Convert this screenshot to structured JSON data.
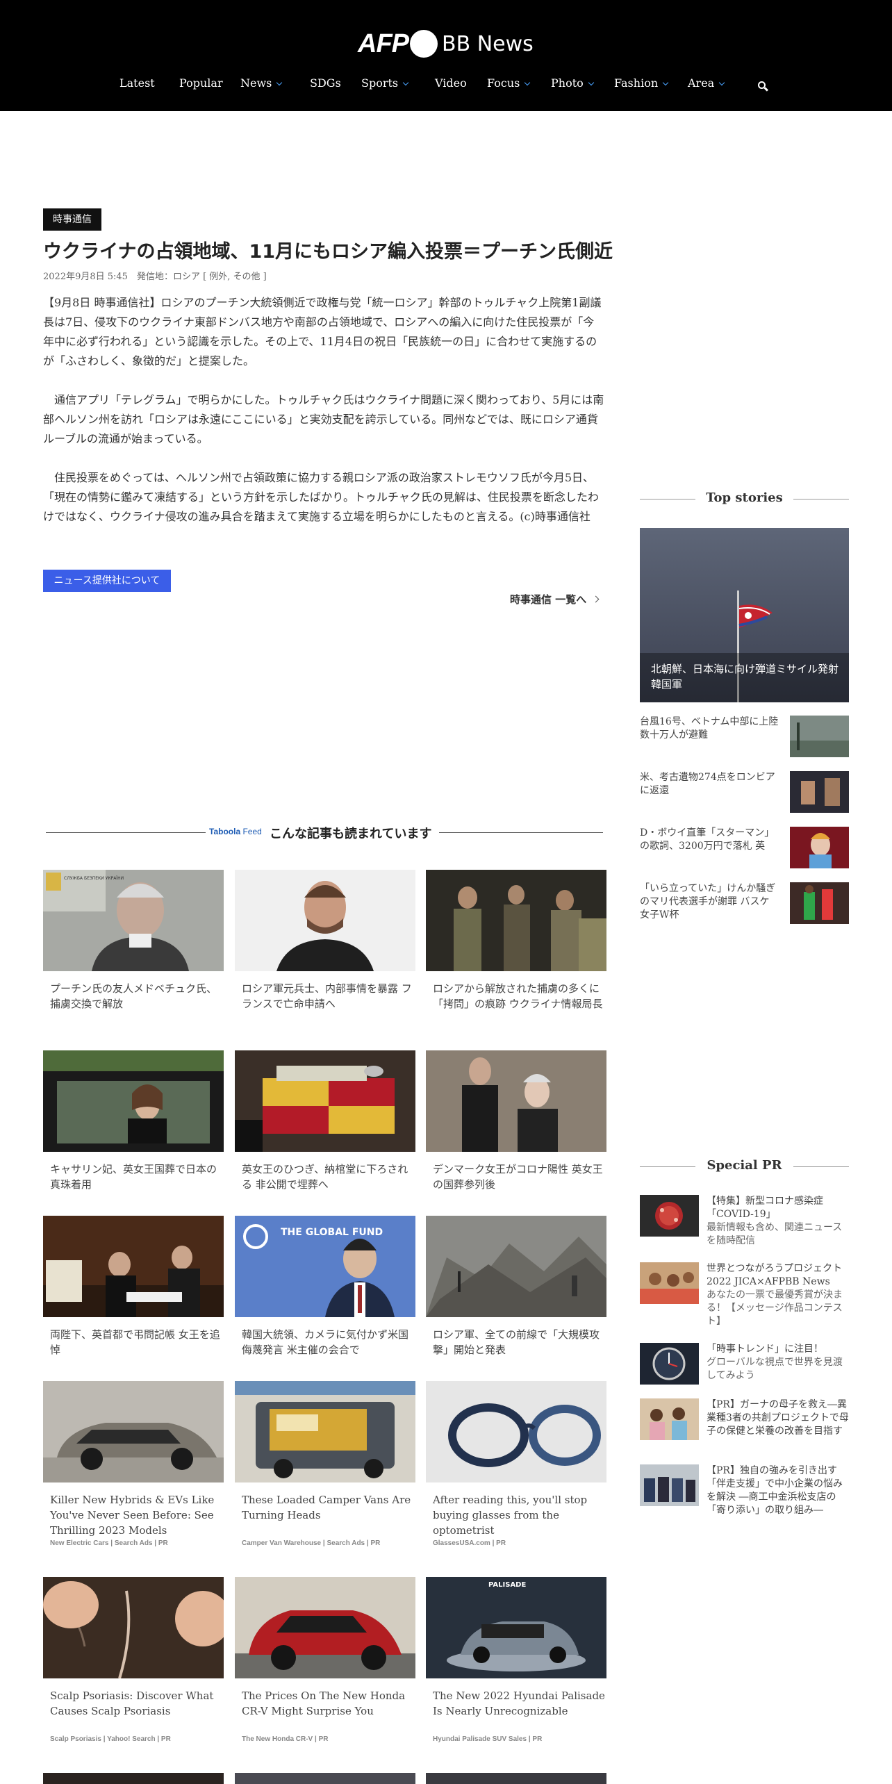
{
  "header": {
    "logo_afp": "AFP",
    "logo_bb": "BB News",
    "nav": [
      {
        "label": "Latest",
        "dropdown": false
      },
      {
        "label": "Popular",
        "dropdown": false
      },
      {
        "label": "News",
        "dropdown": true
      },
      {
        "label": "SDGs",
        "dropdown": false
      },
      {
        "label": "Sports",
        "dropdown": true
      },
      {
        "label": "Video",
        "dropdown": false
      },
      {
        "label": "Focus",
        "dropdown": true
      },
      {
        "label": "Photo",
        "dropdown": true
      },
      {
        "label": "Fashion",
        "dropdown": true
      },
      {
        "label": "Area",
        "dropdown": true
      }
    ],
    "search_icon": "search-icon"
  },
  "article": {
    "tag": "時事通信",
    "title": "ウクライナの占領地域、11月にもロシア編入投票＝プーチン氏側近",
    "meta": "2022年9月8日 5:45　発信地：ロシア [ 例外, その他 ]",
    "paragraphs": [
      "【9月8日 時事通信社】ロシアのプーチン大統領側近で政権与党「統一ロシア」幹部のトゥルチャク上院第1副議長は7日、侵攻下のウクライナ東部ドンバス地方や南部の占領地域で、ロシアへの編入に向けた住民投票が「今年中に必ず行われる」という認識を示した。その上で、11月4日の祝日「民族統一の日」に合わせて実施するのが「ふさわしく、象徴的だ」と提案した。",
      "　通信アプリ「テレグラム」で明らかにした。トゥルチャク氏はウクライナ問題に深く関わっており、5月には南部ヘルソン州を訪れ「ロシアは永遠にここにいる」と実効支配を誇示している。同州などでは、既にロシア通貨ルーブルの流通が始まっている。",
      "　住民投票をめぐっては、ヘルソン州で占領政策に協力する親ロシア派の政治家ストレモウソフ氏が今月5日、「現在の情勢に鑑みて凍結する」という方針を示したばかり。トゥルチャク氏の見解は、住民投票を断念したわけではなく、ウクライナ侵攻の進み具合を踏まえて実施する立場を明らかにしたものと言える。(c)時事通信社"
    ],
    "provider_button": "ニュース提供社について",
    "more_link": "時事通信 一覧へ"
  },
  "taboola": {
    "brand": "Taboola",
    "feed": "Feed",
    "heading": "こんな記事も読まれています"
  },
  "cards": [
    {
      "caption": "プーチン氏の友人メドベチュク氏、捕虜交換で解放",
      "source": ""
    },
    {
      "caption": "ロシア軍元兵士、内部事情を暴露 フランスで亡命申請へ",
      "source": ""
    },
    {
      "caption": "ロシアから解放された捕虜の多くに「拷問」の痕跡 ウクライナ情報局長",
      "source": ""
    },
    {
      "caption": "キャサリン妃、英女王国葬で日本の真珠着用",
      "source": ""
    },
    {
      "caption": "英女王のひつぎ、納棺堂に下ろされる 非公開で埋葬へ",
      "source": ""
    },
    {
      "caption": "デンマーク女王がコロナ陽性 英女王の国葬参列後",
      "source": ""
    },
    {
      "caption": "両陛下、英首都で弔問記帳 女王を追悼",
      "source": ""
    },
    {
      "caption": "韓国大統領、カメラに気付かず米国侮蔑発言 米主催の会合で",
      "source": ""
    },
    {
      "caption": "ロシア軍、全ての前線で「大規模攻撃」開始と発表",
      "source": ""
    },
    {
      "caption": "Killer New Hybrids & EVs Like You've Never Seen Before: See Thrilling 2023 Models",
      "source": "New Electric Cars | Search Ads | PR"
    },
    {
      "caption": "These Loaded Camper Vans Are Turning Heads",
      "source": "Camper Van Warehouse | Search Ads | PR"
    },
    {
      "caption": "After reading this, you'll stop buying glasses from the optometrist",
      "source": "GlassesUSA.com | PR"
    },
    {
      "caption": "Scalp Psoriasis: Discover What Causes Scalp Psoriasis",
      "source": "Scalp Psoriasis | Yahoo! Search | PR"
    },
    {
      "caption": "The Prices On The New Honda CR-V Might Surprise You",
      "source": "The New Honda CR-V | PR"
    },
    {
      "caption": "The New 2022 Hyundai Palisade Is Nearly Unrecognizable",
      "source": "Hyundai Palisade SUV Sales | PR"
    }
  ],
  "card_image_text": {
    "sbu": "СЛУЖБА БЕЗПЕКИ УКРАЇНИ",
    "global_fund": "THE GLOBAL FUND",
    "palisade": "PALISADE"
  },
  "sidebar": {
    "top_stories_title": "Top stories",
    "hero_caption": "北朝鮮、日本海に向け弾道ミサイル発射 韓国軍",
    "stories": [
      {
        "text": "台風16号、ベトナム中部に上陸 数十万人が避難"
      },
      {
        "text": "米、考古遺物274点をロンビアに返還"
      },
      {
        "text": "D・ボウイ直筆「スターマン」の歌詞、3200万円で落札 英"
      },
      {
        "text": "「いら立っていた」けんか騒ぎのマリ代表選手が謝罪 バスケ女子W杯"
      }
    ],
    "special_pr_title": "Special PR",
    "pr": [
      {
        "title": "【特集】新型コロナ感染症「COVID-19」",
        "sub": "最新情報も含め、関連ニュースを随時配信"
      },
      {
        "title": "世界とつながろうプロジェクト2022 JICA×AFPBB News",
        "sub": "あなたの一票で最優秀賞が決まる！【メッセージ作品コンテスト】"
      },
      {
        "title": "「時事トレンド」に注目！",
        "sub": "グローバルな視点で世界を見渡してみよう"
      },
      {
        "title": "【PR】ガーナの母子を救え―異業種3者の共創プロジェクトで母子の保健と栄養の改善を目指す",
        "sub": ""
      },
      {
        "title": "【PR】独自の強みを引き出す「伴走支援」で中小企業の悩みを解決 ―商工中金浜松支店の「寄り添い」の取り組み―",
        "sub": ""
      }
    ]
  },
  "colors": {
    "header_bg": "#000000",
    "accent_blue": "#3b5ee8",
    "chevron_blue": "#4aa3ff"
  }
}
